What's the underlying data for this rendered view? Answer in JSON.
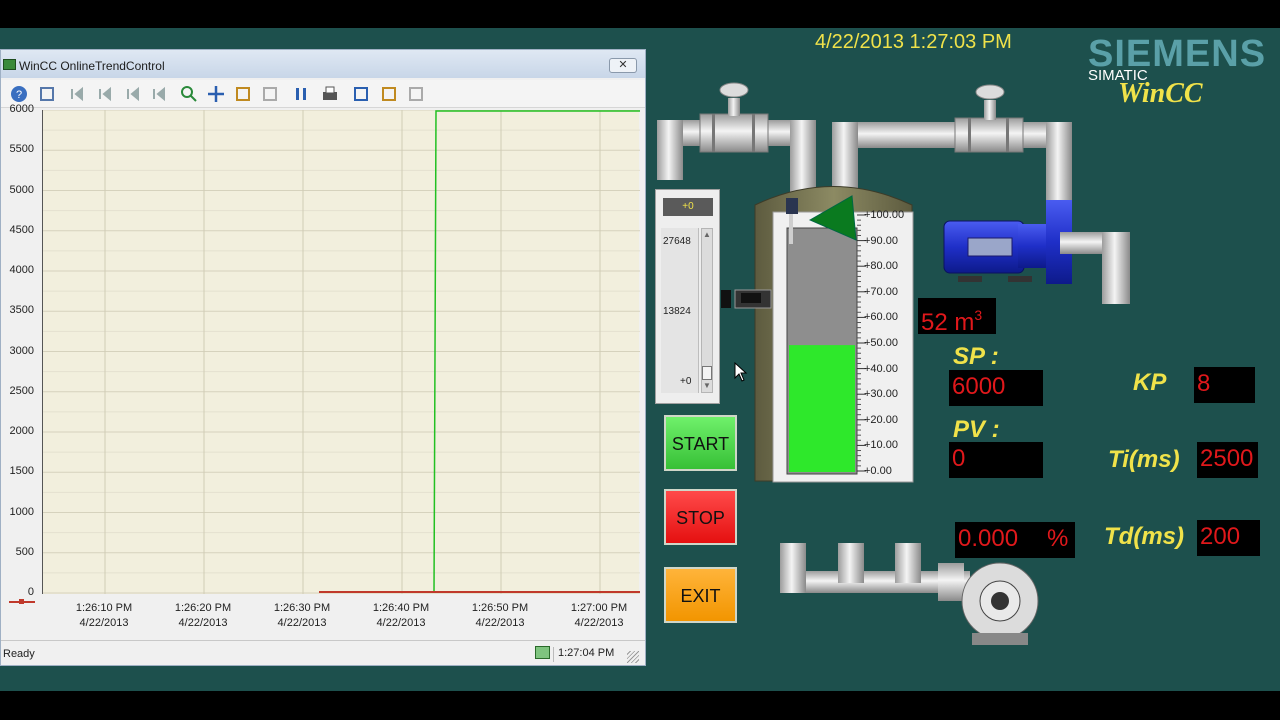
{
  "header": {
    "datetime": "4/22/2013 1:27:03 PM",
    "brand": "SIEMENS",
    "product": "SIMATIC",
    "logo": "WinCC"
  },
  "trend": {
    "title": "WinCC OnlineTrendControl",
    "toolbar_icons": [
      "help-icon",
      "config-icon",
      "first-icon",
      "back-icon",
      "forward-icon",
      "last-icon",
      "zoom-icon",
      "move-icon",
      "zoom-axis-icon",
      "original-view-icon",
      "stop-icon",
      "print-icon",
      "select-data-icon",
      "time-range-icon",
      "ruler-icon"
    ],
    "y_ticks": [
      "6000",
      "5500",
      "5000",
      "4500",
      "4000",
      "3500",
      "3000",
      "2500",
      "2000",
      "1500",
      "1000",
      "500",
      "0"
    ],
    "x_ticks": [
      {
        "time": "1:26:10 PM",
        "date": "4/22/2013"
      },
      {
        "time": "1:26:20 PM",
        "date": "4/22/2013"
      },
      {
        "time": "1:26:30 PM",
        "date": "4/22/2013"
      },
      {
        "time": "1:26:40 PM",
        "date": "4/22/2013"
      },
      {
        "time": "1:26:50 PM",
        "date": "4/22/2013"
      },
      {
        "time": "1:27:00 PM",
        "date": "4/22/2013"
      }
    ],
    "status": "Ready",
    "status_time": "1:27:04 PM",
    "series_colors": {
      "setpoint": "#22c022",
      "process_value": "#c0392b"
    }
  },
  "slider": {
    "value": "+0",
    "labels": [
      "27648",
      "13824",
      "+0"
    ]
  },
  "tank": {
    "scale": [
      "+100.00",
      "+90.00",
      "+80.00",
      "+70.00",
      "+60.00",
      "+50.00",
      "+40.00",
      "+30.00",
      "+20.00",
      "+10.00",
      "+0.00"
    ],
    "level_fraction": 0.52,
    "volume_value": "52 m",
    "volume_exp": "3"
  },
  "controls": {
    "sp_label": "SP :",
    "sp_value": "6000",
    "pv_label": "PV :",
    "pv_value": "0",
    "percent_value": "0.000",
    "percent_unit": "%",
    "kp_label": "KP",
    "kp_value": "8",
    "ti_label": "Ti(ms)",
    "ti_value": "2500",
    "td_label": "Td(ms)",
    "td_value": "200"
  },
  "buttons": {
    "start": "START",
    "stop": "STOP",
    "exit": "EXIT"
  }
}
